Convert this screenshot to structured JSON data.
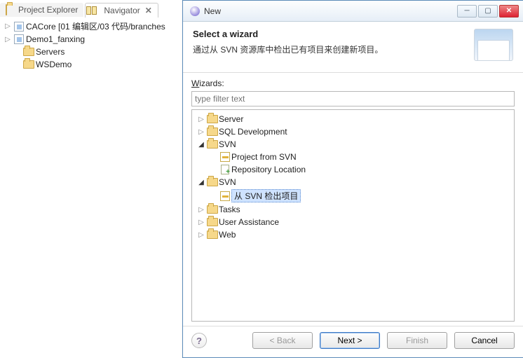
{
  "tabs": {
    "project_explorer": "Project Explorer",
    "navigator": "Navigator"
  },
  "left_tree": {
    "item0": "CACore [01 编辑区/03 代码/branches",
    "item1": "Demo1_fanxing",
    "item2": "Servers",
    "item3": "WSDemo"
  },
  "dialog": {
    "title": "New",
    "header_title": "Select a wizard",
    "header_desc": "通过从 SVN 资源库中检出已有项目来创建新项目。",
    "wizards_label_pre": "",
    "wizards_label_u": "W",
    "wizards_label_post": "izards:",
    "filter_placeholder": "type filter text",
    "buttons": {
      "back": "< Back",
      "next": "Next >",
      "finish": "Finish",
      "cancel": "Cancel"
    }
  },
  "wizard_tree": {
    "server": "Server",
    "sqldev": "SQL Development",
    "svn1": "SVN",
    "proj_from_svn": "Project from SVN",
    "repo_loc": "Repository Location",
    "svn2": "SVN",
    "checkout_svn": "从 SVN 检出项目",
    "tasks": "Tasks",
    "user_assist": "User Assistance",
    "web": "Web"
  }
}
